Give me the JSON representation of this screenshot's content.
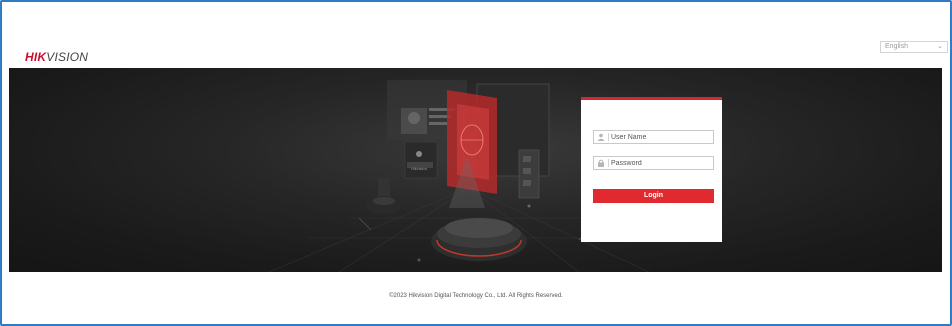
{
  "header": {
    "logo_primary": "HIK",
    "logo_secondary": "VISION",
    "language_selected": "English"
  },
  "login": {
    "username_placeholder": "User Name",
    "password_placeholder": "Password",
    "login_label": "Login"
  },
  "banner": {
    "badge_text": "Hikvision"
  },
  "footer": {
    "copyright": "©2023 Hikvision Digital Technology Co., Ltd. All Rights Reserved."
  },
  "colors": {
    "accent": "#e02a2f",
    "frame_border": "#2f7bc4",
    "banner_bg": "#1e1e1e"
  },
  "icons": {
    "user": "user-icon",
    "lock": "lock-icon",
    "dropdown": "chevron-down-icon"
  }
}
